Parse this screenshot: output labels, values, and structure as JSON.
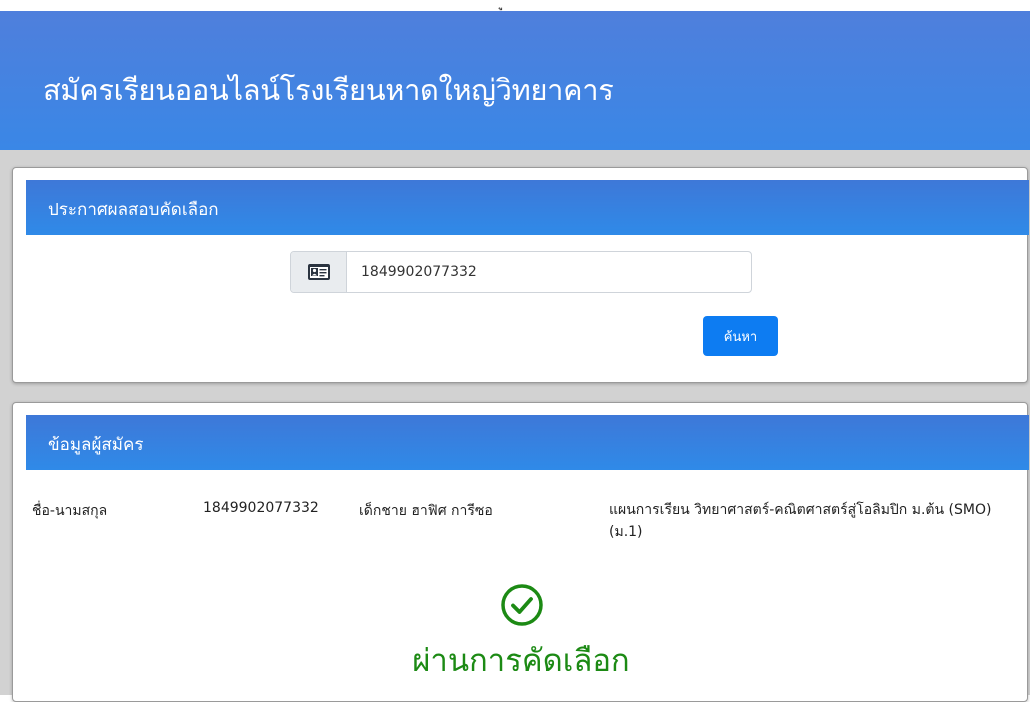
{
  "top_glyph": "ู",
  "header": {
    "title": "สมัครเรียนออนไลน์โรงเรียนหาดใหญ่วิทยาคาร"
  },
  "search_card": {
    "title": "ประกาศผลสอบคัดเลือก",
    "input_value": "1849902077332",
    "prefix_icon": "id-card-icon",
    "button_label": "ค้นหา"
  },
  "applicant_card": {
    "title": "ข้อมูลผู้สมัคร",
    "name_label": "ชื่อ-นามสกุล",
    "id_number": "1849902077332",
    "full_name": "เด็กชาย ฮาฟิศ การีซอ",
    "study_plan": "แผนการเรียน วิทยาศาสตร์-คณิตศาสตร์สู่โอลิมปิก ม.ต้น (SMO)(ม.1)",
    "status_icon": "check-circle-icon",
    "status_text": "ผ่านการคัดเลือก"
  },
  "colors": {
    "header": "#3a87e6",
    "card_header": "#2f8ae8",
    "button": "#0d7cf2",
    "success": "#1c8a14",
    "background_band": "#d2d2d2"
  }
}
